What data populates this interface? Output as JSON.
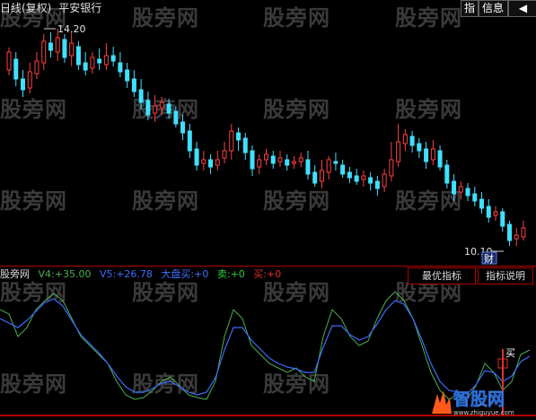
{
  "title": {
    "period": "日线(复权)",
    "stock_name": "平安银行"
  },
  "toolbar": {
    "btn_zhi": "指",
    "btn_info": "信息",
    "btn_nav": "◀"
  },
  "watermark": "股旁网",
  "price_chart": {
    "high_label": "14.20",
    "low_label": "10.10",
    "cai_label": "财"
  },
  "indicator": {
    "name": "股旁网",
    "v4_label": "V4:",
    "v4_value": "+35.00",
    "v5_label": "V5:",
    "v5_value": "+26.78",
    "big_buy_label": "大盘买:",
    "big_buy_value": "+0",
    "sell_label": "卖:",
    "sell_value": "+0",
    "buy_label": "买:",
    "buy_value": "+0",
    "buy_marker": "买",
    "btn_best": "最优指标",
    "btn_help": "指标说明",
    "colors": {
      "v4": "#4caf50",
      "v5": "#3b6cff",
      "big_buy": "#4070ff",
      "sell": "#2ecc40",
      "buy": "#e03030",
      "up_candle": "#ff4040",
      "down_candle": "#40e0ff"
    }
  },
  "logo": {
    "text": "智股网",
    "url_text": "www.zhiguyue.com"
  }
}
